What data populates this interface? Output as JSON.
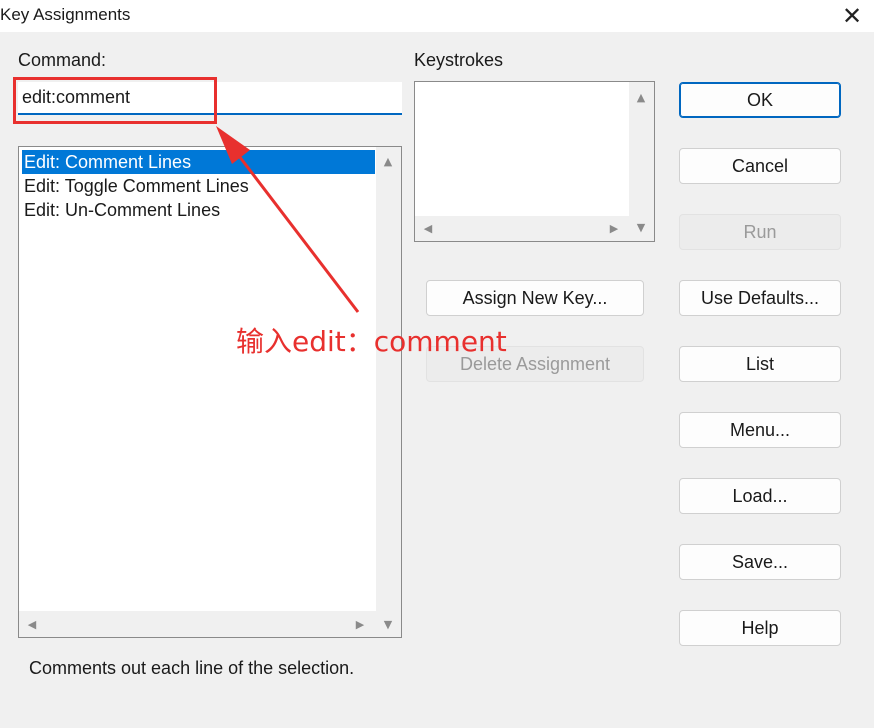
{
  "window": {
    "title": "Key Assignments",
    "close_glyph": "✕"
  },
  "command": {
    "label": "Command:",
    "value": "edit:comment"
  },
  "command_list": {
    "items": [
      {
        "label": "Edit: Comment Lines",
        "selected": true
      },
      {
        "label": "Edit: Toggle Comment Lines",
        "selected": false
      },
      {
        "label": "Edit: Un-Comment Lines",
        "selected": false
      }
    ]
  },
  "keystrokes": {
    "label": "Keystrokes",
    "items": []
  },
  "buttons": {
    "ok": "OK",
    "cancel": "Cancel",
    "run": "Run",
    "assign_new_key": "Assign New Key...",
    "delete_assignment": "Delete Assignment",
    "use_defaults": "Use Defaults...",
    "list": "List",
    "menu": "Menu...",
    "load": "Load...",
    "save": "Save...",
    "help": "Help"
  },
  "annotation": {
    "text": "输入edit：comment",
    "color": "#e8302e"
  },
  "status": {
    "description": "Comments out each line of the selection."
  },
  "colors": {
    "selection": "#0078d7",
    "accent": "#0067c0",
    "annotation_red": "#e8302e"
  }
}
